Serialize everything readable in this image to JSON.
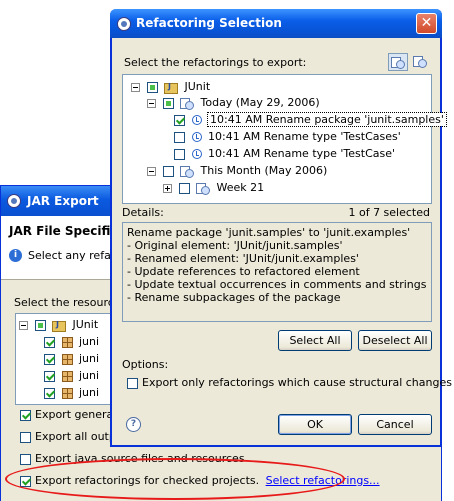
{
  "jar_export": {
    "title": "JAR Export",
    "header_title": "JAR File Specific",
    "header_desc": "Select any refacto",
    "resources_label": "Select the resources",
    "tree": {
      "root": "JUnit",
      "children": [
        "juni",
        "juni",
        "juni",
        "juni"
      ]
    },
    "checks": [
      {
        "label": "Export generate",
        "checked": true
      },
      {
        "label": "Export all outpu",
        "checked": false
      },
      {
        "label": "Export java source files and resources",
        "checked": false
      },
      {
        "label": "Export refactorings for checked projects.",
        "checked": true
      }
    ],
    "select_refactorings_link": "Select refactorings..."
  },
  "dialog": {
    "title": "Refactoring Selection",
    "select_label": "Select the refactorings to export:",
    "tree": {
      "root": "JUnit",
      "today": "Today (May 29, 2006)",
      "items": [
        {
          "label": "10:41 AM Rename package 'junit.samples'",
          "checked": true,
          "selected": true
        },
        {
          "label": "10:41 AM Rename type 'TestCases'",
          "checked": false,
          "selected": false
        },
        {
          "label": "10:41 AM Rename type 'TestCase'",
          "checked": false,
          "selected": false
        }
      ],
      "month": "This Month (May 2006)",
      "week": "Week 21"
    },
    "details_label": "Details:",
    "count_label": "1 of 7 selected",
    "details_lines": [
      "Rename package 'junit.samples' to 'junit.examples'",
      "- Original element: 'JUnit/junit.samples'",
      "- Renamed element: 'JUnit/junit.examples'",
      "- Update references to refactored element",
      "- Update textual occurrences in comments and strings",
      "- Rename subpackages of the package"
    ],
    "select_all": "Select All",
    "deselect_all": "Deselect All",
    "options_label": "Options:",
    "option_structural": "Export only refactorings which cause structural changes",
    "ok": "OK",
    "cancel": "Cancel",
    "help_glyph": "?",
    "close_glyph": "✕"
  },
  "colors": {
    "titlebar": "#0a5ee8",
    "dialog_bg": "#ece9d8",
    "highlight_ellipse": "#e81919",
    "link": "#0000ff"
  }
}
